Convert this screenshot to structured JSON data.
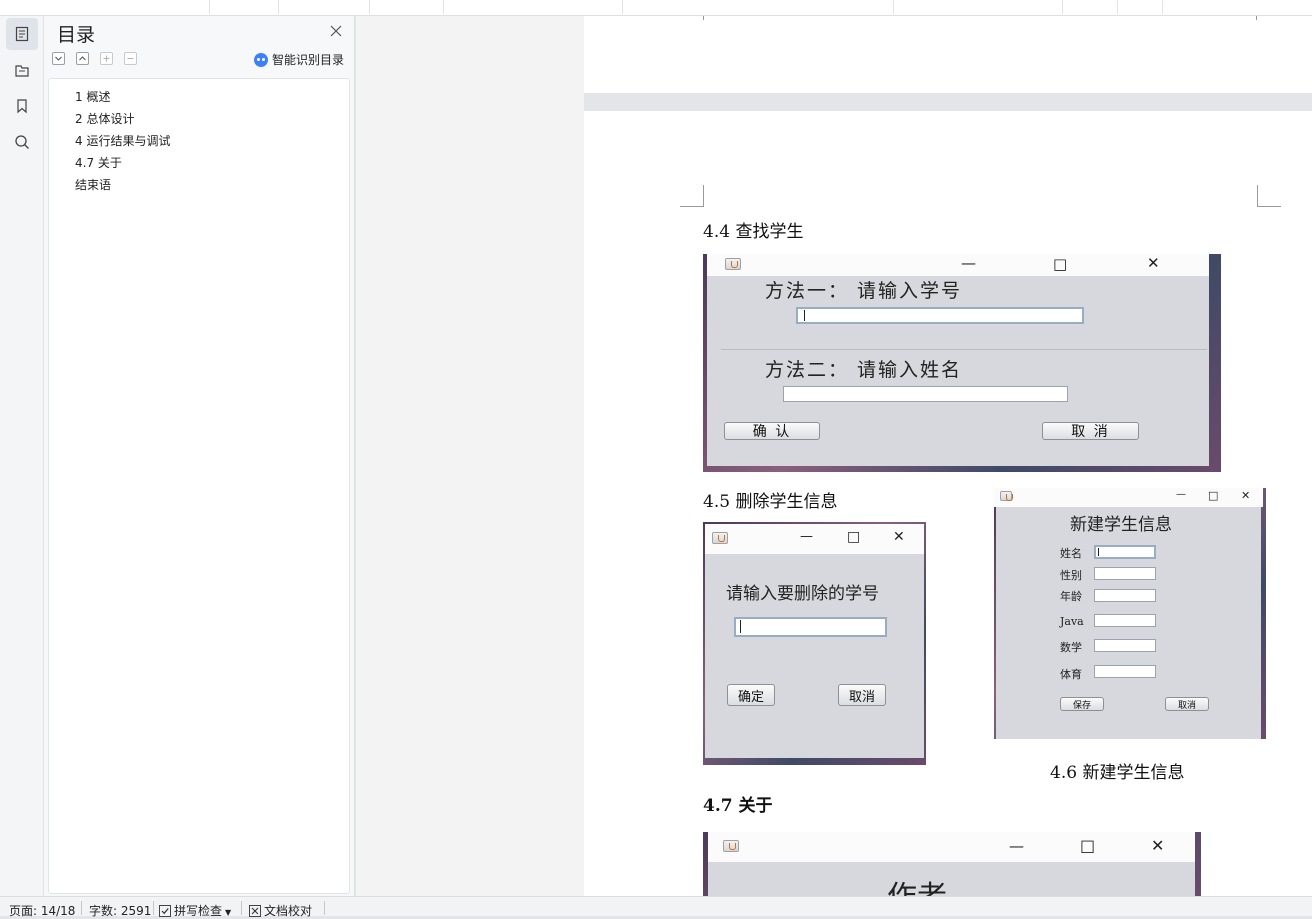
{
  "toc_panel": {
    "title": "目录",
    "smart_toc_label": "智能识别目录",
    "items": [
      {
        "label": "1 概述"
      },
      {
        "label": "2 总体设计"
      },
      {
        "label": "4 运行结果与调试"
      },
      {
        "label": "4.7 关于"
      },
      {
        "label": "结束语"
      }
    ]
  },
  "document": {
    "heading_4_4": "4.4 查找学生",
    "heading_4_5": "4.5 删除学生信息",
    "caption_4_6": "4.6 新建学生信息",
    "heading_4_7": "4.7 关于",
    "find_dialog": {
      "method1": "方法一： 请输入学号",
      "method2": "方法二： 请输入姓名",
      "confirm": "确 认",
      "cancel": "取 消"
    },
    "delete_dialog": {
      "prompt": "请输入要删除的学号",
      "confirm": "确定",
      "cancel": "取消"
    },
    "new_student_dialog": {
      "title": "新建学生信息",
      "fields": [
        {
          "label": "姓名"
        },
        {
          "label": "性别"
        },
        {
          "label": "年龄"
        },
        {
          "label": "Java"
        },
        {
          "label": "数学"
        },
        {
          "label": "体育"
        }
      ],
      "save": "保存",
      "cancel": "取消"
    },
    "about_dialog": {
      "author_text": "作者"
    }
  },
  "status_bar": {
    "page": "页面: 14/18",
    "word_count": "字数: 2591",
    "spell_check": "拼写检查",
    "doc_proofread": "文档校对"
  },
  "colors": {
    "accent": "#3b82f6",
    "panel_bg": "#f7f8fa",
    "page_bg": "#ffffff",
    "workspace_bg": "#e4e5e8"
  }
}
